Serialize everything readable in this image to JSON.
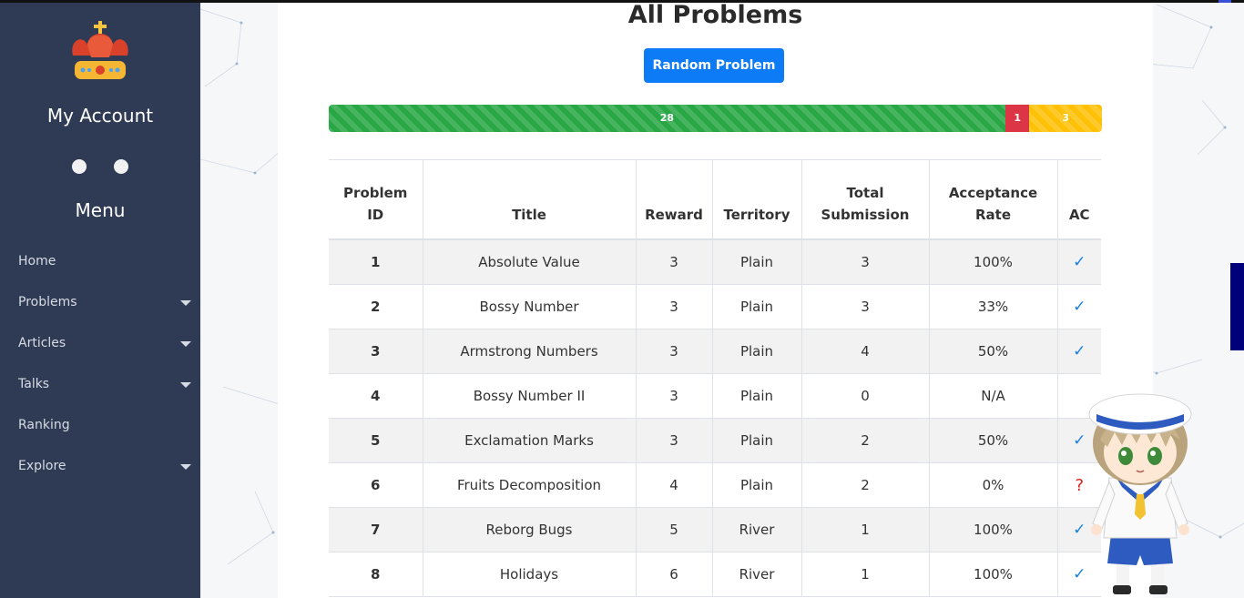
{
  "sidebar": {
    "account_title": "My Account",
    "menu_title": "Menu",
    "items": [
      {
        "label": "Home",
        "has_dropdown": false
      },
      {
        "label": "Problems",
        "has_dropdown": true
      },
      {
        "label": "Articles",
        "has_dropdown": true
      },
      {
        "label": "Talks",
        "has_dropdown": true
      },
      {
        "label": "Ranking",
        "has_dropdown": false
      },
      {
        "label": "Explore",
        "has_dropdown": true
      }
    ]
  },
  "main": {
    "title": "All Problems",
    "random_button": "Random Problem",
    "progress": {
      "segments": [
        {
          "label": "28",
          "value": 28,
          "color": "#28a745"
        },
        {
          "label": "1",
          "value": 1,
          "color": "#dc3545"
        },
        {
          "label": "3",
          "value": 3,
          "color": "#ffc107"
        }
      ]
    },
    "table": {
      "headers": [
        {
          "line1": "Problem",
          "line2": "ID"
        },
        {
          "line1": "",
          "line2": "Title"
        },
        {
          "line1": "",
          "line2": "Reward"
        },
        {
          "line1": "",
          "line2": "Territory"
        },
        {
          "line1": "Total",
          "line2": "Submission"
        },
        {
          "line1": "Acceptance",
          "line2": "Rate"
        },
        {
          "line1": "",
          "line2": "AC"
        }
      ],
      "rows": [
        {
          "id": "1",
          "title": "Absolute Value",
          "reward": "3",
          "territory": "Plain",
          "submissions": "3",
          "rate": "100%",
          "ac": "check"
        },
        {
          "id": "2",
          "title": "Bossy Number",
          "reward": "3",
          "territory": "Plain",
          "submissions": "3",
          "rate": "33%",
          "ac": "check"
        },
        {
          "id": "3",
          "title": "Armstrong Numbers",
          "reward": "3",
          "territory": "Plain",
          "submissions": "4",
          "rate": "50%",
          "ac": "check"
        },
        {
          "id": "4",
          "title": "Bossy Number II",
          "reward": "3",
          "territory": "Plain",
          "submissions": "0",
          "rate": "N/A",
          "ac": "none"
        },
        {
          "id": "5",
          "title": "Exclamation Marks",
          "reward": "3",
          "territory": "Plain",
          "submissions": "2",
          "rate": "50%",
          "ac": "check"
        },
        {
          "id": "6",
          "title": "Fruits Decomposition",
          "reward": "4",
          "territory": "Plain",
          "submissions": "2",
          "rate": "0%",
          "ac": "question"
        },
        {
          "id": "7",
          "title": "Reborg Bugs",
          "reward": "5",
          "territory": "River",
          "submissions": "1",
          "rate": "100%",
          "ac": "check"
        },
        {
          "id": "8",
          "title": "Holidays",
          "reward": "6",
          "territory": "River",
          "submissions": "1",
          "rate": "100%",
          "ac": "check"
        }
      ]
    }
  },
  "icons": {
    "logo": "crown-icon",
    "ac_check": "check-icon",
    "ac_question": "question-icon",
    "dropdown": "caret-down-icon",
    "mascot": "sailor-mascot"
  },
  "colors": {
    "sidebar_bg": "#2f3b55",
    "accent": "#0d7bf5",
    "link": "#1a7fe0",
    "success": "#28a745",
    "danger": "#dc3545",
    "warning": "#ffc107"
  }
}
